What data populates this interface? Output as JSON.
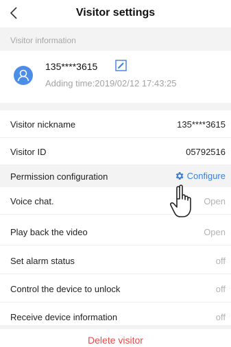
{
  "header": {
    "title": "Visitor settings",
    "back_icon": "chevron-left-icon"
  },
  "section": {
    "visitor_information": "Visitor information"
  },
  "visitor": {
    "phone": "135****3615",
    "adding_time": "Adding time:2019/02/12 17:43:25",
    "avatar_icon": "user-avatar-icon",
    "edit_icon": "edit-icon"
  },
  "rows": {
    "nickname": {
      "label": "Visitor nickname",
      "value": "135****3615"
    },
    "id": {
      "label": "Visitor ID",
      "value": "05792516"
    },
    "permission": {
      "label": "Permission configuration",
      "action": "Configure"
    },
    "voice_chat": {
      "label": "Voice chat.",
      "value": "Open"
    },
    "playback": {
      "label": "Play back the video",
      "value": "Open"
    },
    "alarm": {
      "label": "Set alarm status",
      "value": "off"
    },
    "unlock": {
      "label": "Control the device to unlock",
      "value": "off"
    },
    "receive_info": {
      "label": "Receive device information",
      "value": "off"
    }
  },
  "delete_label": "Delete visitor",
  "colors": {
    "accent_blue": "#3b7fd9",
    "avatar_blue": "#4c8de6",
    "delete_red": "#e84a4a",
    "section_bg": "#f3f3f3"
  }
}
